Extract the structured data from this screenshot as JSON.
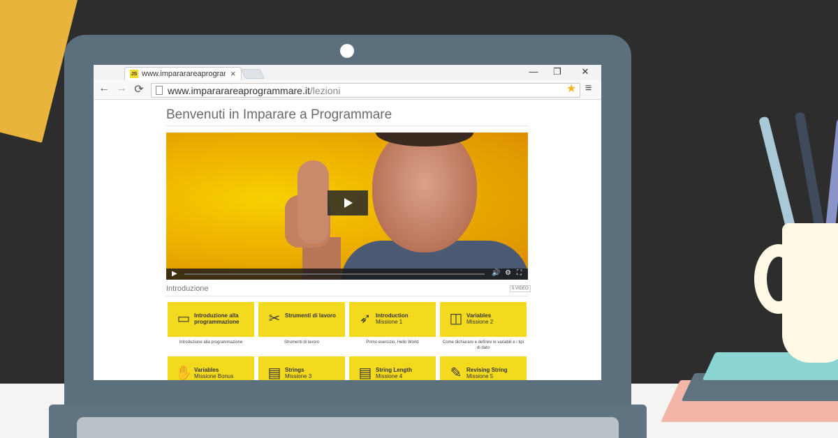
{
  "browser": {
    "tab_title": "www.impararareaprogramm",
    "tab_favicon_text": "JS",
    "tab_close_glyph": "×",
    "window_controls": {
      "minimize": "—",
      "restore": "❐",
      "close": "✕"
    },
    "nav": {
      "back": "←",
      "forward": "→",
      "reload": "⟳"
    },
    "url_host": "www.impararareaprogrammare.it",
    "url_path": "/lezioni",
    "star_glyph": "★",
    "menu_glyph": "≡"
  },
  "page": {
    "title": "Benvenuti in Imparare a Programmare",
    "video": {
      "controls": {
        "play": "▶",
        "volume": "🔊",
        "settings": "⚙",
        "fullscreen": "⛶"
      }
    },
    "section": {
      "title": "Introduzione",
      "badge": "5 VIDEO"
    },
    "cards": [
      {
        "icon": "browser-window-icon",
        "glyph": "▭",
        "label": "Introduzione alla",
        "sub": "programmazione",
        "desc": "Introduzione alla programmazione",
        "sub_bold": true
      },
      {
        "icon": "tools-icon",
        "glyph": "✂",
        "label": "Strumenti di lavoro",
        "sub": "",
        "desc": "Strumenti di lavoro",
        "sub_bold": false
      },
      {
        "icon": "rocket-icon",
        "glyph": "➶",
        "label": "Introduction",
        "sub": "Missione 1",
        "desc": "Primo esercizio, Hello World",
        "sub_bold": false
      },
      {
        "icon": "cup-icon",
        "glyph": "◫",
        "label": "Variables",
        "sub": "Missione 2",
        "desc": "Come dichiarare e definire le variabili e i tipi di dato",
        "sub_bold": false
      },
      {
        "icon": "handshake-icon",
        "glyph": "✋",
        "label": "Variables",
        "sub": "Missione Bonus",
        "desc": "",
        "sub_bold": false
      },
      {
        "icon": "document-icon",
        "glyph": "▤",
        "label": "Strings",
        "sub": "Missione 3",
        "desc": "",
        "sub_bold": false
      },
      {
        "icon": "ruler-document-icon",
        "glyph": "▤",
        "label": "String Length",
        "sub": "Missione 4",
        "desc": "",
        "sub_bold": false
      },
      {
        "icon": "edit-document-icon",
        "glyph": "✎",
        "label": "Revising String",
        "sub": "Missione 5",
        "desc": "",
        "sub_bold": false
      }
    ]
  },
  "colors": {
    "card_yellow": "#f3da1f",
    "laptop": "#5b6f7c",
    "background": "#2d2d2d",
    "accent_star": "#f2b51a"
  }
}
